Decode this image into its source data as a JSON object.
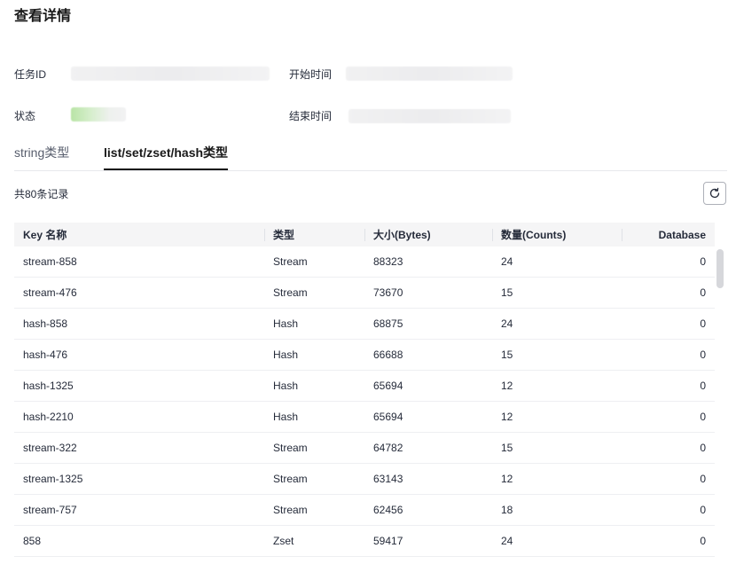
{
  "page": {
    "title": "查看详情"
  },
  "info": {
    "task_id_label": "任务ID",
    "start_time_label": "开始时间",
    "status_label": "状态",
    "end_time_label": "结束时间"
  },
  "tabs": [
    {
      "label": "string类型",
      "active": false
    },
    {
      "label": "list/set/zset/hash类型",
      "active": true
    }
  ],
  "records": {
    "count_text": "共80条记录",
    "refresh_icon": "refresh-icon"
  },
  "table": {
    "headers": [
      "Key 名称",
      "类型",
      "大小(Bytes)",
      "数量(Counts)",
      "Database"
    ],
    "rows": [
      [
        "stream-858",
        "Stream",
        "88323",
        "24",
        "0"
      ],
      [
        "stream-476",
        "Stream",
        "73670",
        "15",
        "0"
      ],
      [
        "hash-858",
        "Hash",
        "68875",
        "24",
        "0"
      ],
      [
        "hash-476",
        "Hash",
        "66688",
        "15",
        "0"
      ],
      [
        "hash-1325",
        "Hash",
        "65694",
        "12",
        "0"
      ],
      [
        "hash-2210",
        "Hash",
        "65694",
        "12",
        "0"
      ],
      [
        "stream-322",
        "Stream",
        "64782",
        "15",
        "0"
      ],
      [
        "stream-1325",
        "Stream",
        "63143",
        "12",
        "0"
      ],
      [
        "stream-757",
        "Stream",
        "62456",
        "18",
        "0"
      ],
      [
        "858",
        "Zset",
        "59417",
        "24",
        "0"
      ]
    ]
  },
  "colors": {
    "status_indicator": "#b9e4a6",
    "active_tab": "#191919",
    "header_bg": "#f5f5f6"
  }
}
